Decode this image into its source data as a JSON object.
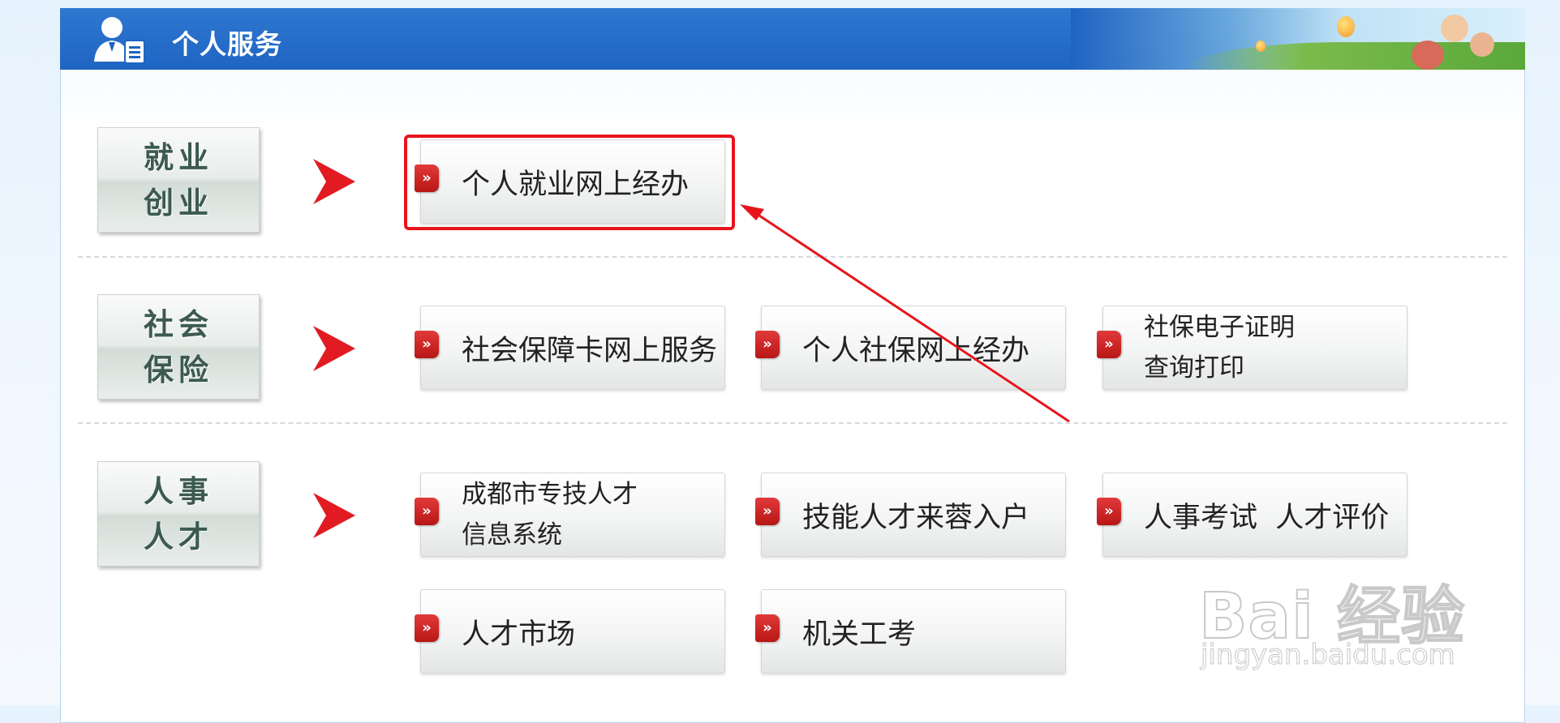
{
  "header": {
    "title": "个人服务"
  },
  "categories": [
    {
      "line1": "就业",
      "line2": "创业"
    },
    {
      "line1": "社会",
      "line2": "保险"
    },
    {
      "line1": "人事",
      "line2": "人才"
    }
  ],
  "services": {
    "employment": [
      {
        "label": "个人就业网上经办"
      }
    ],
    "social_insurance": [
      {
        "label": "社会保障卡网上服务"
      },
      {
        "label": "个人社保网上经办"
      },
      {
        "line1": "社保电子证明",
        "line2": "查询打印"
      }
    ],
    "talent": [
      {
        "line1": "成都市专技人才",
        "line2": "信息系统"
      },
      {
        "label": "技能人才来蓉入户"
      },
      {
        "label": "人事考试  人才评价"
      },
      {
        "label": "人才市场"
      },
      {
        "label": "机关工考"
      }
    ]
  },
  "icons": {
    "service_tag": "double-chevron-icon",
    "category_arrow": "red-arrow-icon",
    "header_icon": "user-profile-icon"
  },
  "watermark": {
    "brand": "Bai 经验",
    "url": "jingyan.baidu.com"
  },
  "colors": {
    "header_bg": "#1f64c2",
    "accent_red": "#e8141c",
    "category_text": "#3c5a50"
  }
}
